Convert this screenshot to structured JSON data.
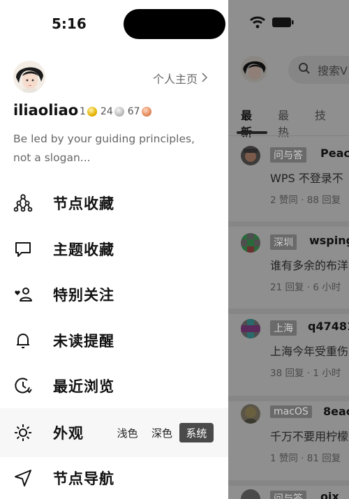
{
  "status_bar": {
    "time": "5:16"
  },
  "profile": {
    "profile_link": "个人主页",
    "username": "iliaoliao",
    "gold": "1",
    "silver": "24",
    "bronze": "67",
    "bio_line1": "Be led by your guiding principles,",
    "bio_line2": "not a slogan..."
  },
  "menu": {
    "node_favorites": "节点收藏",
    "topic_favorites": "主题收藏",
    "special_follow": "特别关注",
    "unread_reminders": "未读提醒",
    "recent_browse": "最近浏览",
    "appearance": "外观",
    "node_navigation": "节点导航"
  },
  "appearance_options": {
    "light": "浅色",
    "dark": "深色",
    "system": "系统",
    "selected": "系统"
  },
  "main": {
    "search_placeholder": "搜索V",
    "tabs": [
      "最新",
      "最热",
      "技"
    ],
    "posts": [
      {
        "node": "问与答",
        "author": "Peac",
        "title": "WPS 不登录不",
        "meta": "2 赞同 · 88 回复"
      },
      {
        "node": "深圳",
        "author": "wsping",
        "title": "谁有多余的布洋",
        "meta": "21 回复 · 6 小时"
      },
      {
        "node": "上海",
        "author": "q47481",
        "title": "上海今年受重伤",
        "meta": "38 回复 · 1 小时"
      },
      {
        "node": "macOS",
        "author": "8eac",
        "title": "千万不要用柠檬",
        "meta": "1 赞同 · 81 回复"
      },
      {
        "node": "问与答",
        "author": "oix"
      }
    ]
  },
  "colors": {
    "selected_segment": "#4a4a4a",
    "overlay": "#8f8f8f"
  }
}
